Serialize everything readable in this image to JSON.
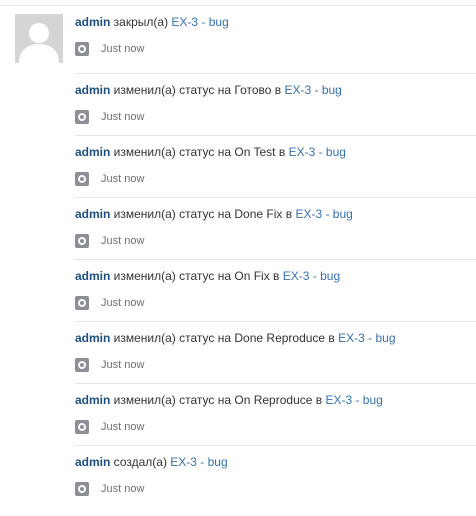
{
  "avatar": {
    "icon": "user-avatar-icon"
  },
  "entries": [
    {
      "actor": "admin",
      "action": " закрыл(а) ",
      "issue": "EX-3 - bug",
      "time": "Just now"
    },
    {
      "actor": "admin",
      "action": " изменил(а) статус на Готово в ",
      "issue": "EX-3 - bug",
      "time": "Just now"
    },
    {
      "actor": "admin",
      "action": " изменил(а) статус на On Test в ",
      "issue": "EX-3 - bug",
      "time": "Just now"
    },
    {
      "actor": "admin",
      "action": " изменил(а) статус на Done Fix в ",
      "issue": "EX-3 - bug",
      "time": "Just now"
    },
    {
      "actor": "admin",
      "action": " изменил(а) статус на On Fix в ",
      "issue": "EX-3 - bug",
      "time": "Just now"
    },
    {
      "actor": "admin",
      "action": " изменил(а) статус на Done Reproduce в ",
      "issue": "EX-3 - bug",
      "time": "Just now"
    },
    {
      "actor": "admin",
      "action": " изменил(а) статус на On Reproduce в ",
      "issue": "EX-3 - bug",
      "time": "Just now"
    },
    {
      "actor": "admin",
      "action": " создал(а) ",
      "issue": "EX-3 - bug",
      "time": "Just now"
    }
  ],
  "colors": {
    "actor": "#205081",
    "link": "#3572b0",
    "status_icon": "#8c8f96",
    "divider": "#e4e4e4"
  }
}
